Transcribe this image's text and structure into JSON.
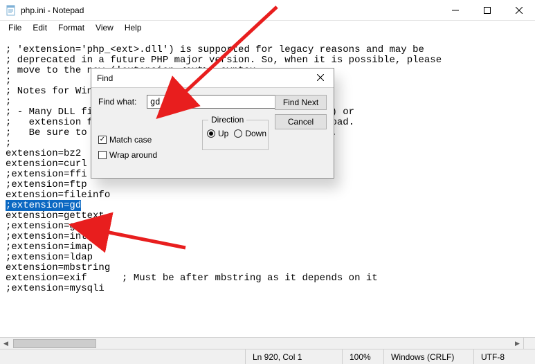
{
  "window": {
    "title": "php.ini - Notepad",
    "buttons": {
      "min": "Minimize",
      "max": "Maximize",
      "close": "Close"
    }
  },
  "menu": {
    "file": "File",
    "edit": "Edit",
    "format": "Format",
    "view": "View",
    "help": "Help"
  },
  "editor": {
    "line1": "; 'extension='php_<ext>.dll') is supported for legacy reasons and may be",
    "line2": "; deprecated in a future PHP major version. So, when it is possible, please",
    "line3": "; move to the new ('extension=<ext>) syntax.",
    "line4": ";",
    "line5": "; Notes for Windows environments :",
    "line6": ";",
    "line7a": "; - Many DLL files are located in the extensions/ (PHP 4) or",
    "line8a": ";   extension folders as well as the separate PECL DLL download.",
    "line8b": "load.",
    "line9a": ";   Be sure to appropriately set the extension_dir directive.",
    "line9b": "e.",
    "line10": ";",
    "line11": "extension=bz2",
    "line12": "extension=curl",
    "line13": ";extension=ffi",
    "line14": ";extension=ftp",
    "line15": "extension=fileinfo",
    "line16": ";extension=gd",
    "line17": "extension=gettext",
    "line18": ";extension=gmp",
    "line19": ";extension=intl",
    "line20": ";extension=imap",
    "line21": ";extension=ldap",
    "line22": "extension=mbstring",
    "line23": "extension=exif      ; Must be after mbstring as it depends on it",
    "line24": ";extension=mysqli"
  },
  "find": {
    "title": "Find",
    "findwhat_label": "Find what:",
    "findwhat_value": "gd",
    "find_next": "Find Next",
    "cancel": "Cancel",
    "direction_label": "Direction",
    "up": "Up",
    "down": "Down",
    "matchcase": "Match case",
    "wraparound": "Wrap around"
  },
  "status": {
    "pos": "Ln 920, Col 1",
    "zoom": "100%",
    "eol": "Windows (CRLF)",
    "enc": "UTF-8"
  }
}
